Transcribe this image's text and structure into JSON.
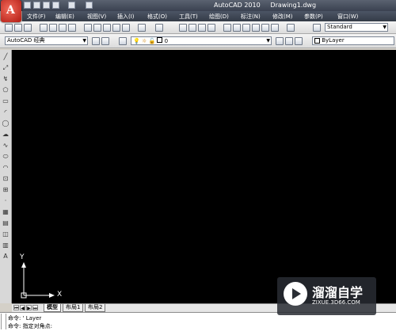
{
  "title_bar": {
    "app_name": "AutoCAD 2010",
    "document": "Drawing1.dwg"
  },
  "menu": [
    "文件(F)",
    "编辑(E)",
    "视图(V)",
    "插入(I)",
    "格式(O)",
    "工具(T)",
    "绘图(D)",
    "标注(N)",
    "修改(M)",
    "参数(P)",
    "窗口(W)"
  ],
  "toolbar": {
    "text_style": "Standard",
    "workspace": "AutoCAD 经典",
    "layer": "0",
    "color": "ByLayer"
  },
  "canvas": {
    "axis_y": "Y",
    "axis_x": "X"
  },
  "tabs": [
    "模型",
    "布局1",
    "布局2"
  ],
  "command": {
    "line1": "命令: ' Layer",
    "line2": "命令: 指定对角点:"
  },
  "watermark": {
    "brand": "溜溜自学",
    "url": "ZIXUE.3D66.COM"
  }
}
